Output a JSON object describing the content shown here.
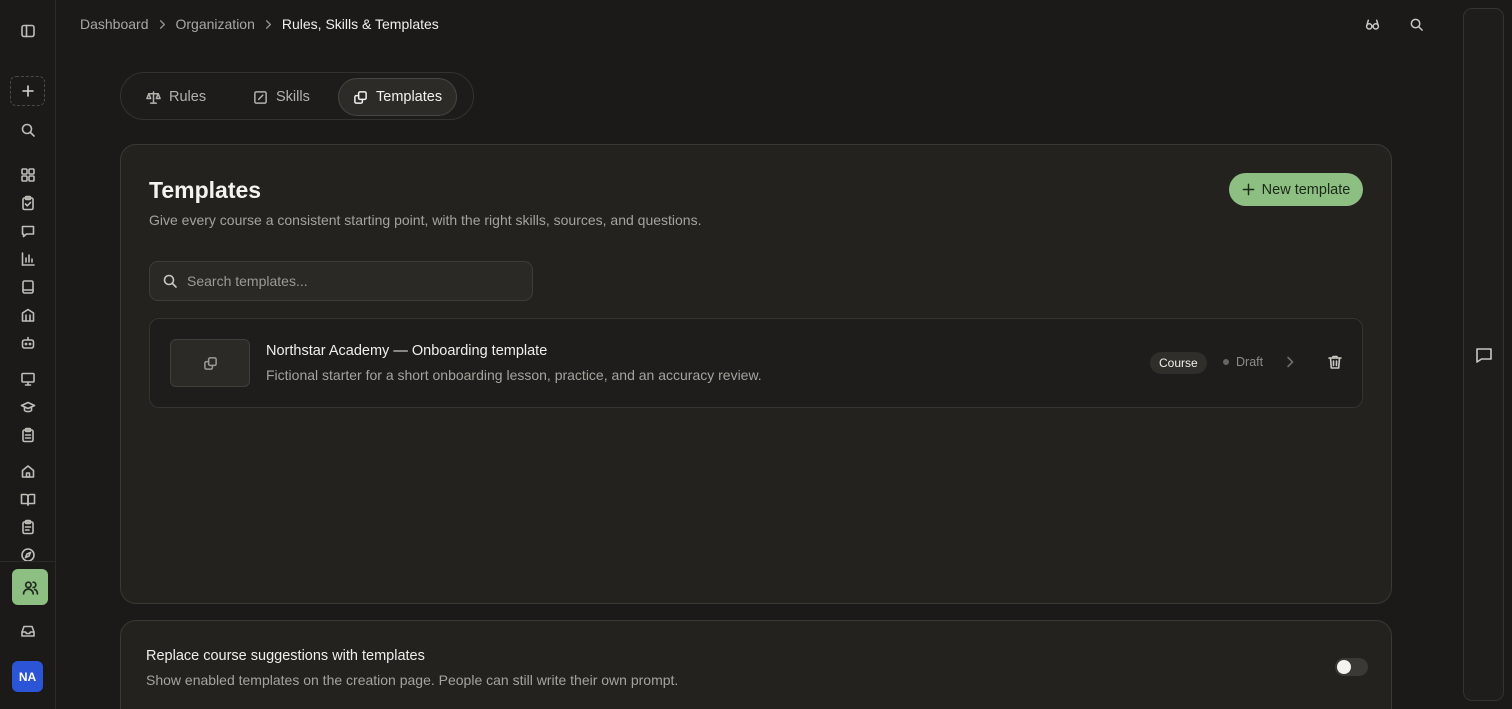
{
  "breadcrumb": {
    "items": [
      "Dashboard",
      "Organization"
    ],
    "current": "Rules, Skills & Templates"
  },
  "rail": {
    "avatar_initials": "NA",
    "accent_color": "#8dbf83"
  },
  "tabs": [
    {
      "label": "Rules",
      "icon": "scale-icon",
      "active": false
    },
    {
      "label": "Skills",
      "icon": "edit-box-icon",
      "active": false
    },
    {
      "label": "Templates",
      "icon": "copy-icon",
      "active": true
    }
  ],
  "templates_card": {
    "title": "Templates",
    "subtitle": "Give every course a consistent starting point, with the right skills, sources, and questions.",
    "new_button_label": "New template",
    "search_placeholder": "Search templates...",
    "items": [
      {
        "title": "Northstar Academy — Onboarding template",
        "description": "Fictional starter for a short onboarding lesson, practice, and an accuracy review.",
        "badge": "Course",
        "status": "Draft"
      }
    ]
  },
  "settings": {
    "title": "Replace course suggestions with templates",
    "description": "Show enabled templates on the creation page. People can still write their own prompt.",
    "toggle_on": false
  }
}
